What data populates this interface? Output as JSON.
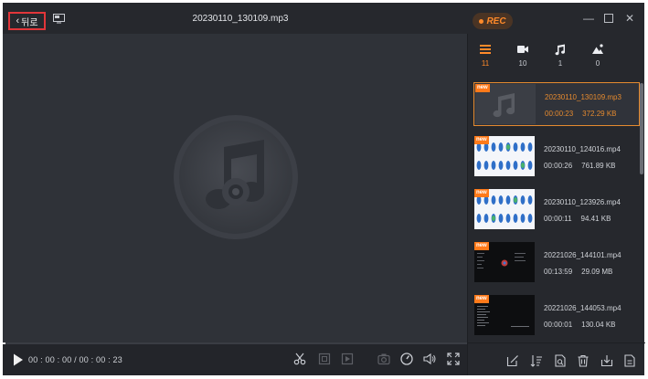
{
  "titlebar": {
    "back_label": "뒤로",
    "file_title": "20230110_130109.mp3",
    "rec_label": "REC"
  },
  "colors": {
    "accent": "#ff8a2a",
    "highlight_border": "#e2363a"
  },
  "player": {
    "time_text": "00 : 00 : 00 / 00 : 00 : 23",
    "progress": 0.0
  },
  "categories": [
    {
      "name": "all",
      "icon": "list-icon",
      "count": "11"
    },
    {
      "name": "video",
      "icon": "video-camera-icon",
      "count": "10"
    },
    {
      "name": "audio",
      "icon": "music-note-icon",
      "count": "1"
    },
    {
      "name": "image",
      "icon": "image-icon",
      "count": "0"
    }
  ],
  "recordings": [
    {
      "name": "20230110_130109.mp3",
      "duration": "00:00:23",
      "size": "372.29 KB",
      "new_tag": "new",
      "kind": "audio"
    },
    {
      "name": "20230110_124016.mp4",
      "duration": "00:00:26",
      "size": "761.89 KB",
      "new_tag": "new",
      "kind": "video"
    },
    {
      "name": "20230110_123926.mp4",
      "duration": "00:00:11",
      "size": "94.41 KB",
      "new_tag": "new",
      "kind": "video"
    },
    {
      "name": "20221026_144101.mp4",
      "duration": "00:13:59",
      "size": "29.09 MB",
      "new_tag": "new",
      "kind": "video"
    },
    {
      "name": "20221026_144053.mp4",
      "duration": "00:00:01",
      "size": "130.04 KB",
      "new_tag": "new",
      "kind": "video"
    }
  ]
}
